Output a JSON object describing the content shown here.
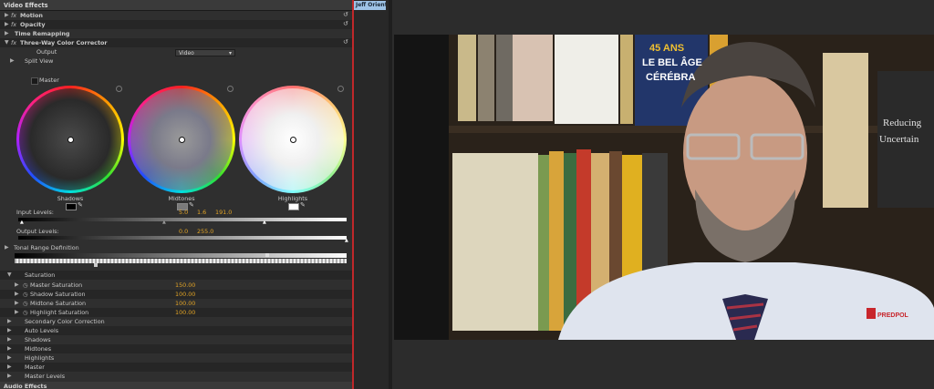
{
  "panel": {
    "title": "Video Effects",
    "motion": "Motion",
    "opacity": "Opacity",
    "time_remapping": "Time Remapping",
    "tcc": "Three-Way Color Corrector",
    "output_label": "Output",
    "output_value": "Video",
    "split_view": "Split View",
    "master_checkbox": "Master",
    "wheels": {
      "shadows": "Shadows",
      "midtones": "Midtones",
      "highlights": "Highlights"
    },
    "input_levels_label": "Input Levels:",
    "input_levels": {
      "black": "5.0",
      "gamma": "1.6",
      "white": "191.0"
    },
    "output_levels_label": "Output Levels:",
    "output_levels": {
      "black": "0.0",
      "white": "255.0"
    },
    "tonal_range": "Tonal Range Definition",
    "saturation": "Saturation",
    "sat_rows": [
      {
        "label": "Master Saturation",
        "value": "150.00"
      },
      {
        "label": "Shadow Saturation",
        "value": "100.00"
      },
      {
        "label": "Midtone Saturation",
        "value": "100.00"
      },
      {
        "label": "Highlight Saturation",
        "value": "100.00"
      }
    ],
    "other_rows": [
      "Secondary Color Correction",
      "Auto Levels",
      "Shadows",
      "Midtones",
      "Highlights",
      "Master",
      "Master Levels"
    ],
    "audio_effects": "Audio Effects"
  },
  "timeline": {
    "clip_label": "Jeff Orientat"
  },
  "video": {
    "brand": "PREDPOL",
    "books": [
      "45 ANS",
      "LE BEL ÂGE",
      "CÉRÉBRA",
      "Reducing",
      "Uncertain"
    ]
  },
  "colors": {
    "accent_value": "#e3a425",
    "selection_line": "#c0282a",
    "clip": "#9ec3e6",
    "brand_red": "#c8262c"
  },
  "icons": [
    "reset-icon",
    "disclosure-triangle-icon",
    "fx-icon",
    "eyedropper-icon",
    "stopwatch-icon"
  ]
}
